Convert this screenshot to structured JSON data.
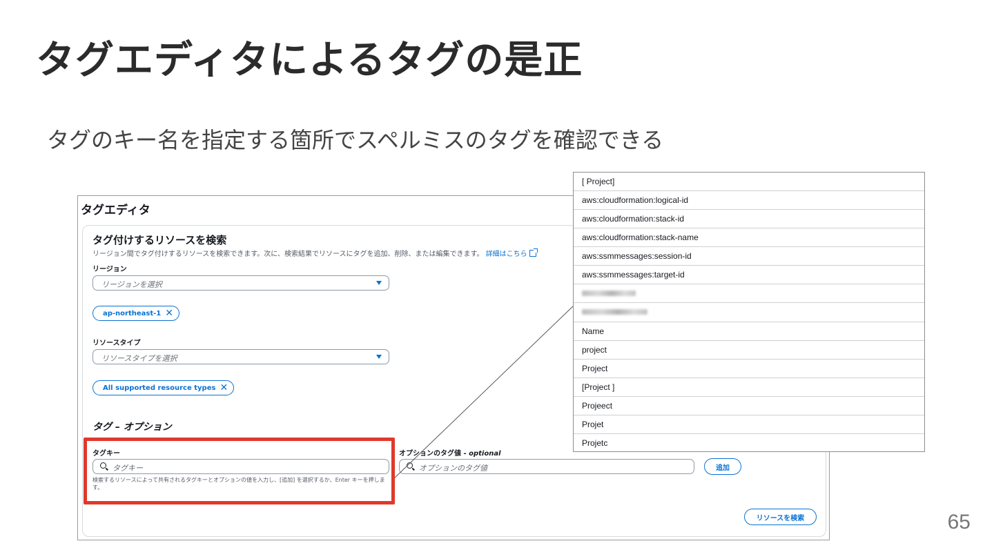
{
  "slide": {
    "title": "タグエディタによるタグの是正",
    "subtitle": "タグのキー名を指定する箇所でスペルミスのタグを確認できる",
    "page_number": "65"
  },
  "panel": {
    "heading": "タグエディタ",
    "search_section": {
      "title": "タグ付けするリソースを検索",
      "description": "リージョン間でタグ付けするリソースを検索できます。次に、検索結果でリソースにタグを追加、削除、または編集できます。",
      "detail_link": "詳細はこちら"
    },
    "region": {
      "label": "リージョン",
      "placeholder": "リージョンを選択",
      "token": "ap-northeast-1"
    },
    "resource_type": {
      "label": "リソースタイプ",
      "placeholder": "リソースタイプを選択",
      "token": "All supported resource types"
    },
    "tags_section": {
      "title": "タグ – オプション",
      "tag_key_label": "タグキー",
      "tag_key_placeholder": "タグキー",
      "tag_value_label": "オプションのタグ値",
      "tag_value_optional": "optional",
      "tag_value_placeholder": "オプションのタグ値",
      "helper_text": "検索するリソースによって共有されるタグキーとオプションの値を入力し、[追加] を選択するか、Enter キーを押します。",
      "add_button": "追加"
    },
    "search_button": "リソースを検索"
  },
  "dropdown": {
    "items": [
      "[ Project]",
      "aws:cloudformation:logical-id",
      "aws:cloudformation:stack-id",
      "aws:cloudformation:stack-name",
      "aws:ssmmessages:session-id",
      "aws:ssmmessages:target-id",
      "",
      "",
      "Name",
      "project",
      "Project",
      "[Project ]",
      "Projeect",
      "Projet",
      "Projetc"
    ]
  },
  "colors": {
    "accent": "#0972d3",
    "highlight": "#e0392b"
  }
}
